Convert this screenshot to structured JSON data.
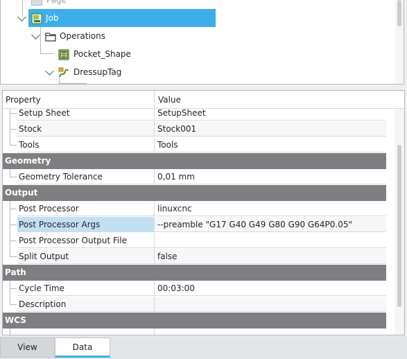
{
  "tree": {
    "items": [
      {
        "label": "Page"
      },
      {
        "label": "Job"
      },
      {
        "label": "Operations"
      },
      {
        "label": "Pocket_Shape"
      },
      {
        "label": "DressupTag"
      }
    ]
  },
  "properties": {
    "header": {
      "property": "Property",
      "value": "Value"
    },
    "rows": [
      {
        "name": "Setup Sheet",
        "value": "SetupSheet"
      },
      {
        "name": "Stock",
        "value": "Stock001"
      },
      {
        "name": "Tools",
        "value": "Tools"
      },
      {
        "group": "Geometry"
      },
      {
        "name": "Geometry Tolerance",
        "value": "0,01 mm"
      },
      {
        "group": "Output"
      },
      {
        "name": "Post Processor",
        "value": "linuxcnc"
      },
      {
        "name": "Post Processor Args",
        "value": "--preamble \"G17 G40 G49 G80 G90 G64P0.05\""
      },
      {
        "name": "Post Processor Output File",
        "value": ""
      },
      {
        "name": "Split Output",
        "value": "false"
      },
      {
        "group": "Path"
      },
      {
        "name": "Cycle Time",
        "value": "00:03:00"
      },
      {
        "name": "Description",
        "value": ""
      },
      {
        "group": "WCS"
      }
    ]
  },
  "tabs": [
    {
      "label": "View"
    },
    {
      "label": "Data"
    }
  ],
  "colors": {
    "selection": "#3daee9",
    "selected_cell": "#c2e0f4",
    "group_header": "#7d7f82"
  }
}
